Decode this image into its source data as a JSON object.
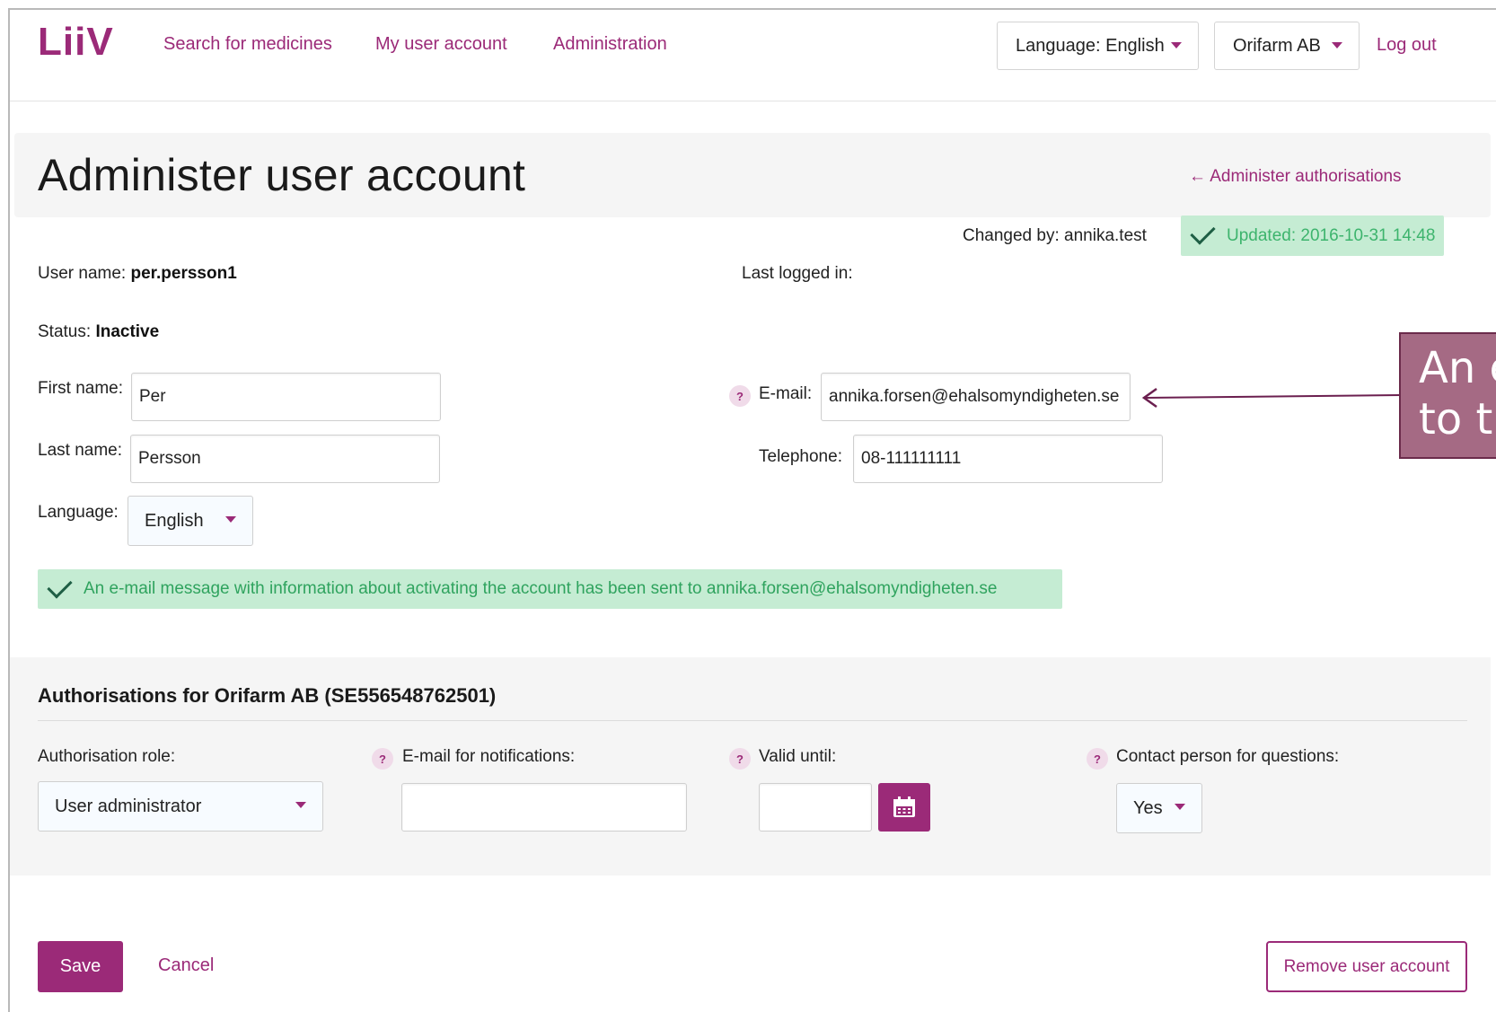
{
  "header": {
    "logo": "LiiV",
    "nav": [
      "Search for medicines",
      "My user account",
      "Administration"
    ],
    "language_select": "Language: English",
    "org_select": "Orifarm AB",
    "logout": "Log out"
  },
  "page": {
    "title": "Administer user account",
    "back_link": "← Administer authorisations",
    "changed_by": "Changed by: annika.test",
    "updated": "Updated: 2016-10-31 14:48"
  },
  "user": {
    "username_label": "User name:",
    "username": "per.persson1",
    "last_logged_label": "Last logged in:",
    "status_label": "Status:",
    "status": "Inactive",
    "first_name_label": "First name:",
    "first_name": "Per",
    "last_name_label": "Last name:",
    "last_name": "Persson",
    "email_label": "E-mail:",
    "email": "annika.forsen@ehalsomyndigheten.se",
    "telephone_label": "Telephone:",
    "telephone": "08-111111111",
    "language_label": "Language:",
    "language": "English"
  },
  "notice": "An e-mail message with information about activating the account has been sent to annika.forsen@ehalsomyndigheten.se",
  "auth": {
    "title": "Authorisations for Orifarm AB (SE556548762501)",
    "role_label": "Authorisation role:",
    "role_value": "User administrator",
    "email_notif_label": "E-mail for notifications:",
    "email_notif_value": "",
    "valid_until_label": "Valid until:",
    "valid_until_value": "",
    "contact_label": "Contact person for questions:",
    "contact_value": "Yes"
  },
  "actions": {
    "save": "Save",
    "cancel": "Cancel",
    "remove": "Remove user account"
  },
  "callout": {
    "line1": "An e",
    "line2": "to th"
  },
  "colors": {
    "accent": "#9b2a78",
    "success_bg": "#c5ecd3",
    "success_text": "#3db46d"
  }
}
